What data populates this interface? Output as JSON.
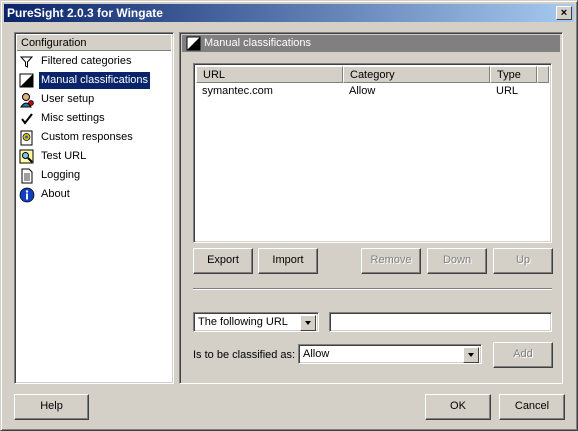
{
  "window": {
    "title": "PureSight 2.0.3 for Wingate",
    "close_glyph": "×"
  },
  "sidebar": {
    "header": "Configuration",
    "items": [
      {
        "label": "Filtered categories",
        "icon": "filter-icon"
      },
      {
        "label": "Manual classifications",
        "icon": "manual-classification-icon",
        "selected": true
      },
      {
        "label": "User setup",
        "icon": "user-setup-icon"
      },
      {
        "label": "Misc settings",
        "icon": "checkmark-icon"
      },
      {
        "label": "Custom responses",
        "icon": "custom-responses-icon"
      },
      {
        "label": "Test URL",
        "icon": "test-url-icon"
      },
      {
        "label": "Logging",
        "icon": "logging-icon"
      },
      {
        "label": "About",
        "icon": "info-icon"
      }
    ]
  },
  "main": {
    "header": "Manual classifications",
    "list": {
      "columns": [
        "URL",
        "Category",
        "Type"
      ],
      "rows": [
        {
          "url": "symantec.com",
          "category": "Allow",
          "type": "URL"
        }
      ]
    },
    "buttons": {
      "export": "Export",
      "import": "Import",
      "remove": "Remove",
      "down": "Down",
      "up": "Up",
      "add": "Add"
    },
    "url_mode": {
      "selected": "The following URL"
    },
    "url_value": "",
    "classify_label": "Is to be classified as:",
    "classification": {
      "selected": "Allow"
    }
  },
  "footer": {
    "help": "Help",
    "ok": "OK",
    "cancel": "Cancel"
  }
}
